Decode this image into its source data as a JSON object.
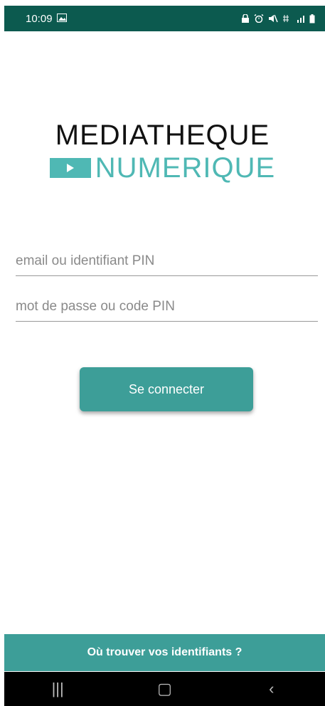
{
  "status_bar": {
    "time": "10:09",
    "background": "#0c5a4f"
  },
  "logo": {
    "line1": "MEDIATHEQUE",
    "line2": "NUMERIQUE",
    "accent": "#4fb8b4"
  },
  "login": {
    "email_placeholder": "email ou identifiant PIN",
    "password_placeholder": "mot de passe ou code PIN",
    "submit_label": "Se connecter",
    "button_color": "#3d9e98"
  },
  "footer": {
    "link_label": "Où trouver vos identifiants ?"
  },
  "nav": {
    "recents_icon": "|||",
    "home_icon": "▢",
    "back_icon": "‹"
  }
}
